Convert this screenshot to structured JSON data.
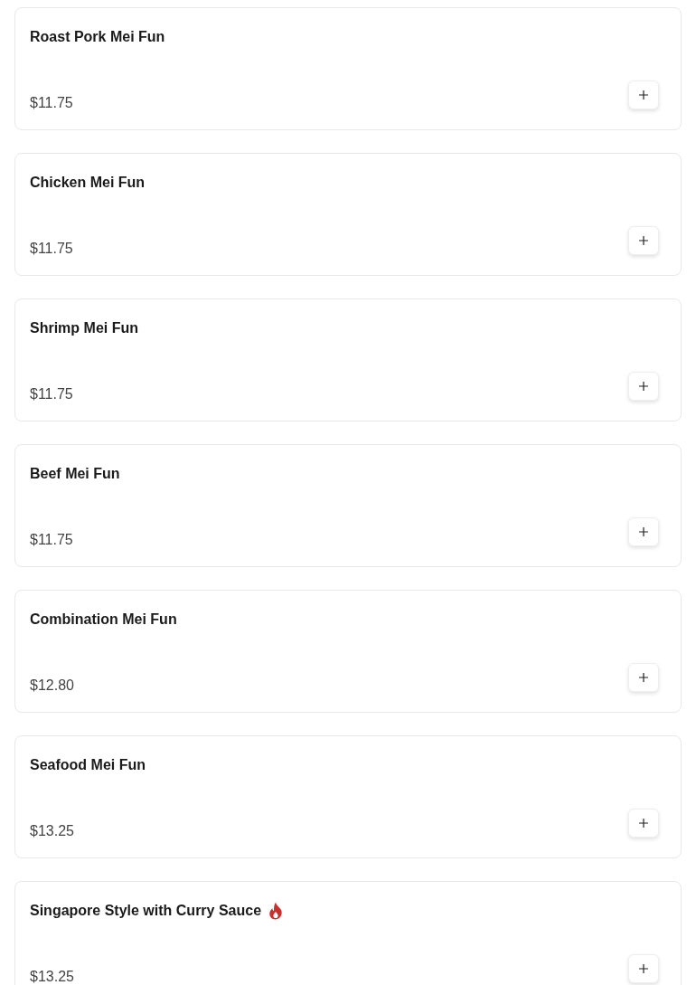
{
  "menu_items": [
    {
      "name": "Roast Pork Mei Fun",
      "price": "$11.75",
      "spicy": false
    },
    {
      "name": "Chicken Mei Fun",
      "price": "$11.75",
      "spicy": false
    },
    {
      "name": "Shrimp Mei Fun",
      "price": "$11.75",
      "spicy": false
    },
    {
      "name": "Beef Mei Fun",
      "price": "$11.75",
      "spicy": false
    },
    {
      "name": "Combination Mei Fun",
      "price": "$12.80",
      "spicy": false
    },
    {
      "name": "Seafood Mei Fun",
      "price": "$13.25",
      "spicy": false
    },
    {
      "name": "Singapore Style with Curry Sauce",
      "price": "$13.25",
      "spicy": true
    }
  ]
}
